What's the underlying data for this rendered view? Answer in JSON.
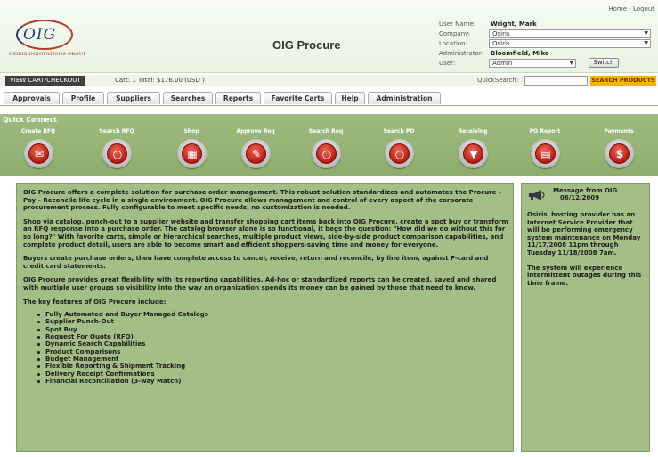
{
  "header": {
    "logo_text": "OIG",
    "logo_subtext": "OSIRIS INNOVATIONS GROUP",
    "app_title": "OIG Procure",
    "links": [
      "Home",
      "Logout"
    ],
    "link_separator": "-",
    "user_fields": {
      "user_name_label": "User Name:",
      "user_name": "Wright, Mark",
      "company_label": "Company:",
      "company": "Osiris",
      "location_label": "Location:",
      "location": "Osiris",
      "administrator_label": "Administrator:",
      "administrator": "Bloomfield, Mike",
      "user_label": "User:",
      "user": "Admin",
      "switch_label": "Switch"
    }
  },
  "cartbar": {
    "cart_button": "VIEW CART/CHECKOUT",
    "cart_info": "Cart: 1  Total: $176.00 (USD )",
    "quicksearch_label": "QuickSearch:",
    "quicksearch_value": "",
    "search_button": "SEARCH PRODUCTS"
  },
  "tabs": [
    "Approvals",
    "Profile",
    "Suppliers",
    "Searches",
    "Reports",
    "Favorite Carts",
    "Help",
    "Administration"
  ],
  "quick_connect": {
    "title": "Quick Connect",
    "items": [
      {
        "label": "Create RFQ",
        "icon": "envelope-icon"
      },
      {
        "label": "Search RFQ",
        "icon": "magnifier-icon"
      },
      {
        "label": "Shop",
        "icon": "cart-icon"
      },
      {
        "label": "Approve Req",
        "icon": "clipboard-icon"
      },
      {
        "label": "Search Req",
        "icon": "magnifier-icon"
      },
      {
        "label": "Search PO",
        "icon": "magnifier-icon"
      },
      {
        "label": "Receiving",
        "icon": "download-icon"
      },
      {
        "label": "PO Report",
        "icon": "printer-icon"
      },
      {
        "label": "Payments",
        "icon": "dollar-icon"
      }
    ]
  },
  "main": {
    "paragraphs": [
      "OIG Procure offers a complete solution for purchase order management. This robust solution standardizes and automates the Procure – Pay – Reconcile life cycle in a single environment. OIG Procure allows management and control of every aspect of the corporate procurement process. Fully configurable to meet specific needs, no customization is needed.",
      "Shop via catalog, punch-out to a supplier website and transfer shopping cart items back into OIG Procure, create a spot buy or transform an RFQ response into a purchase order. The catalog browser alone is so functional, it begs the question: \"How did we do without this for so long?\" With favorite carts, simple or hierarchical searches, multiple product views, side-by-side product comparison capabilities, and complete product detail, users are able to become smart and efficient shoppers-saving time and money for everyone.",
      "Buyers create purchase orders, then have complete access to cancel, receive, return and reconcile, by line item, against P-card and credit card statements.",
      "OIG Procure provides great flexibility with its reporting capabilities. Ad-hoc or standardized reports can be created, saved and shared with multiple user groups so visibility into the way an organization spends its money can be gained by those that need to know.",
      "The key features of OIG Procure include:"
    ],
    "features": [
      "Fully Automated and Buyer Managed Catalogs",
      "Supplier Punch-Out",
      "Spot Buy",
      "Request For Quote (RFQ)",
      "Dynamic Search Capabilities",
      "Product Comparisons",
      "Budget Management",
      "Flexible Reporting & Shipment Tracking",
      "Delivery Receipt Confirmations",
      "Financial Reconciliation (3-way Match)"
    ]
  },
  "message": {
    "title_line1": "Message from OIG",
    "title_line2": "06/12/2009",
    "body": [
      "Osiris' hosting provider has an Internet Service Provider that will be performing emergency system maintenance on Monday 11/17/2008 11pm through Tuesday 11/18/2008 7am.",
      "The system will experience intermittent outages during this time frame."
    ]
  },
  "colors": {
    "panel_green": "#a3be87",
    "quick_connect_green": "#94b275",
    "search_button": "#f4b400",
    "icon_red": "#b0180e"
  }
}
